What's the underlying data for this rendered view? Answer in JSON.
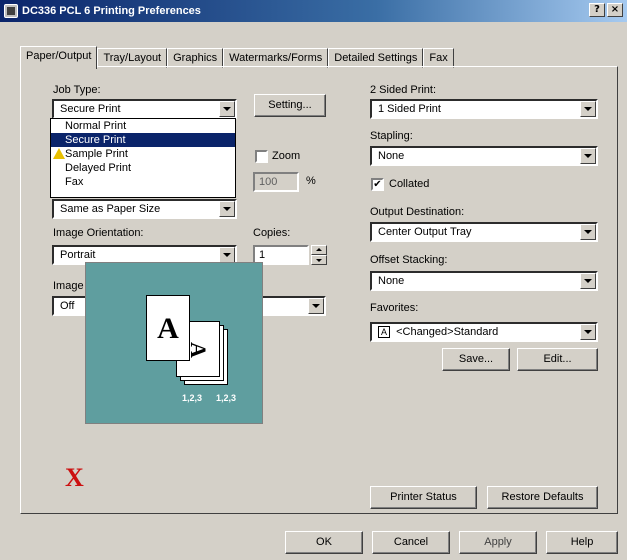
{
  "window": {
    "title": "DC336 PCL 6 Printing Preferences",
    "help_btn": "?",
    "close_btn": "×"
  },
  "tabs": [
    "Paper/Output",
    "Tray/Layout",
    "Graphics",
    "Watermarks/Forms",
    "Detailed Settings",
    "Fax"
  ],
  "job_type": {
    "label": "Job Type:",
    "value": "Secure Print",
    "options": [
      "Normal Print",
      "Secure Print",
      "Sample Print",
      "Delayed Print",
      "Fax"
    ],
    "selected_option": "Secure Print",
    "settings_button": "Setting..."
  },
  "paper_size_partial": "Same as Paper Size",
  "zoom": {
    "label": "Zoom",
    "checked": false,
    "value": "100",
    "unit": "%"
  },
  "orientation": {
    "label": "Image Orientation:",
    "value": "Portrait"
  },
  "copies": {
    "label": "Copies:",
    "value": "1"
  },
  "rotation": {
    "label": "Image Rotation (180deg):",
    "value": "Off"
  },
  "two_sided": {
    "label": "2 Sided Print:",
    "value": "1 Sided Print"
  },
  "stapling": {
    "label": "Stapling:",
    "value": "None"
  },
  "collated": {
    "label": "Collated",
    "checked": true,
    "mark": "✔"
  },
  "output_dest": {
    "label": "Output Destination:",
    "value": "Center Output Tray"
  },
  "offset": {
    "label": "Offset Stacking:",
    "value": "None"
  },
  "favorites": {
    "label": "Favorites:",
    "value": "<Changed>Standard",
    "icon_text": "A",
    "save": "Save...",
    "edit": "Edit..."
  },
  "preview": {
    "letter": "A",
    "collate_labels": [
      "1,2,3",
      "1,2,3"
    ],
    "x_mark": "X"
  },
  "panel_buttons": {
    "printer_status": "Printer Status",
    "restore_defaults": "Restore Defaults"
  },
  "dialog_buttons": {
    "ok": "OK",
    "cancel": "Cancel",
    "apply": "Apply",
    "help": "Help"
  }
}
